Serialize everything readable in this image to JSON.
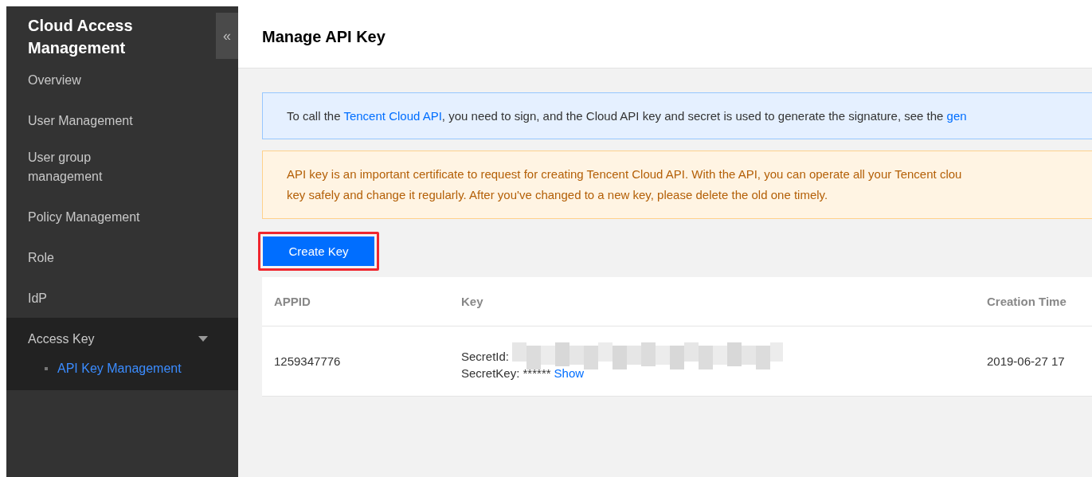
{
  "sidebar": {
    "title": "Cloud Access Management",
    "collapse_icon": "«",
    "items": [
      {
        "label": "Overview",
        "selected": false
      },
      {
        "label": "User Management",
        "selected": false
      },
      {
        "label": "User group management",
        "selected": false
      },
      {
        "label": "Policy Management",
        "selected": false
      },
      {
        "label": "Role",
        "selected": false
      },
      {
        "label": "IdP",
        "selected": false
      },
      {
        "label": "Access Key",
        "selected": false,
        "expanded": true,
        "children": [
          {
            "label": "API Key Management",
            "selected": true
          }
        ]
      }
    ]
  },
  "page": {
    "title": "Manage API Key",
    "info": {
      "before": "To call the ",
      "link": "Tencent Cloud API",
      "after": ", you need to sign, and the Cloud API key and secret is used to generate the signature, see the ",
      "link2": "gen"
    },
    "warning": {
      "lines": [
        "API key is an important certificate to request for creating Tencent Cloud API. With the API, you can operate all your Tencent clou",
        "key safely and change it regularly. After you've changed to a new key, please delete the old one timely."
      ]
    },
    "create_button": {
      "label": "Create Key",
      "highlighted": true
    },
    "table": {
      "columns": [
        "APPID",
        "Key",
        "Creation Time"
      ],
      "rows": [
        {
          "appid": "1259347776",
          "secret_id_label": "SecretId:",
          "secret_key_label": "SecretKey: ******",
          "show_link": "Show",
          "creation_time": "2019-06-27 17"
        }
      ]
    }
  }
}
